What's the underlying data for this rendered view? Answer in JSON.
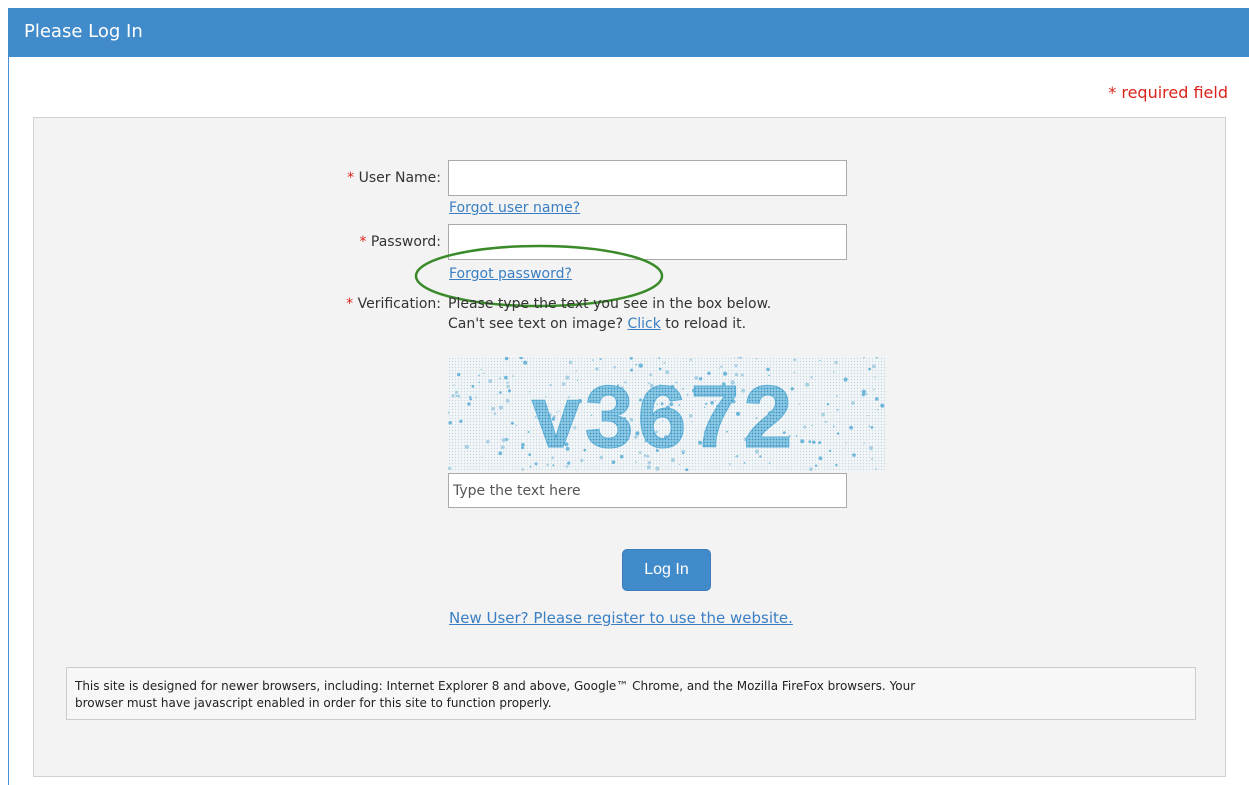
{
  "header": {
    "title": "Please Log In"
  },
  "required_note": "* required field",
  "form": {
    "required_star": "*",
    "username": {
      "label": "User Name:",
      "value": "",
      "placeholder": ""
    },
    "forgot_username": "Forgot user name?",
    "password": {
      "label": "Password:",
      "value": "",
      "placeholder": ""
    },
    "forgot_password": "Forgot password?",
    "verification": {
      "label": "Verification:",
      "instruction": "Please type the text you see in the box below.",
      "reload_prefix": "Can't see text on image?",
      "reload_link": "Click",
      "reload_suffix": "to reload it.",
      "captcha_text": "v3672",
      "input_placeholder": "Type the text here",
      "input_value": ""
    },
    "login_button": "Log In",
    "register_link": "New User? Please register to use the website."
  },
  "notice": {
    "line1": "This site is designed for newer browsers, including: Internet Explorer 8 and above, Google™ Chrome, and the Mozilla FireFox browsers. Your",
    "line2": "browser must have javascript enabled in order for this site to function properly."
  },
  "colors": {
    "header_bg": "#428bca",
    "required_red": "#d9241c",
    "link_blue": "#3a7fc3",
    "captcha_blue": "#5aaed6",
    "highlight_green": "#3a8a2a"
  }
}
